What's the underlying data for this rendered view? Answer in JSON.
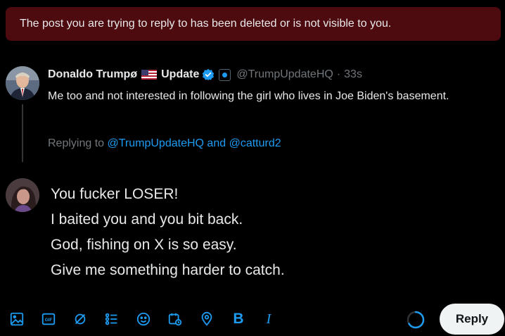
{
  "banner": {
    "text": "The post you are trying to reply to has been deleted or is not visible to you."
  },
  "original_post": {
    "author_name_part1": "Donaldo Trumpø",
    "author_name_part2": "Update",
    "handle": "@TrumpUpdateHQ",
    "separator": "·",
    "time": "33s",
    "text": "Me too and not interested in following the girl who lives in Joe Biden's basement.",
    "replying_prefix": "Replying to",
    "replying_user1": "@TrumpUpdateHQ",
    "replying_and": "and",
    "replying_user2": "@catturd2",
    "verified_color": "#1d9bf0"
  },
  "compose": {
    "lines": [
      "You fucker LOSER!",
      "I baited you and you bit back.",
      "God, fishing on X is so easy.",
      "Give me something harder to catch."
    ]
  },
  "toolbar": {
    "icons": [
      "image-icon",
      "gif-icon",
      "grok-icon",
      "poll-icon",
      "emoji-icon",
      "schedule-icon",
      "location-icon",
      "bold-icon",
      "italic-icon"
    ],
    "bold_label": "B",
    "italic_label": "I",
    "gif_label": "GIF",
    "reply_label": "Reply",
    "accent": "#1d9bf0",
    "char_progress": 0.66
  }
}
